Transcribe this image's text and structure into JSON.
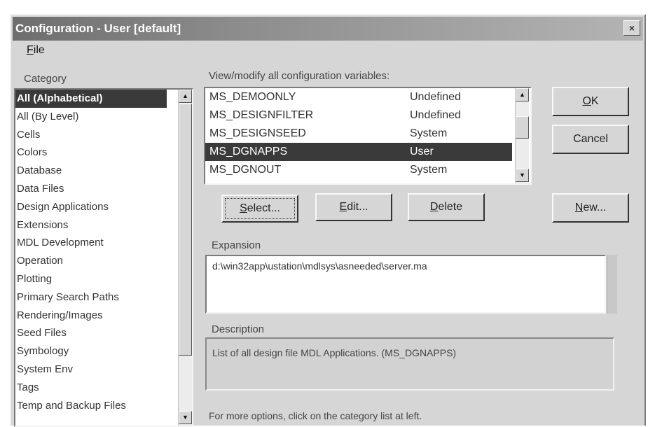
{
  "window": {
    "title": "Configuration - User [default]",
    "close_glyph": "×"
  },
  "menu": {
    "file_mnemonic": "F",
    "file_rest": "ile"
  },
  "category": {
    "label": "Category",
    "items": [
      "All (Alphabetical)",
      "All (By Level)",
      "Cells",
      "Colors",
      "Database",
      "Data Files",
      "Design Applications",
      "Extensions",
      "MDL Development",
      "Operation",
      "Plotting",
      "Primary Search Paths",
      "Rendering/Images",
      "Seed Files",
      "Symbology",
      "System Env",
      "Tags",
      "Temp and Backup Files"
    ],
    "selected_index": 0
  },
  "variables": {
    "label": "View/modify all configuration variables:",
    "rows": [
      {
        "name": "MS_DEMOONLY",
        "level": "Undefined"
      },
      {
        "name": "MS_DESIGNFILTER",
        "level": "Undefined"
      },
      {
        "name": "MS_DESIGNSEED",
        "level": "System"
      },
      {
        "name": "MS_DGNAPPS",
        "level": "User"
      },
      {
        "name": "MS_DGNOUT",
        "level": "System"
      }
    ],
    "selected_index": 3
  },
  "buttons": {
    "ok": {
      "mnemonic": "O",
      "rest": "K"
    },
    "cancel": "Cancel",
    "select": {
      "mnemonic": "S",
      "rest": "elect..."
    },
    "edit": {
      "mnemonic": "E",
      "rest": "dit..."
    },
    "delete": {
      "mnemonic": "D",
      "rest": "elete"
    },
    "new": {
      "mnemonic": "N",
      "rest": "ew..."
    }
  },
  "expansion": {
    "label": "Expansion",
    "value": "d:\\win32app\\ustation\\mdlsys\\asneeded\\server.ma"
  },
  "description": {
    "label": "Description",
    "text": "List of all design file MDL Applications. (MS_DGNAPPS)"
  },
  "footer_hint": "For more options, click on the category list at left.",
  "scroll_arrows": {
    "up": "▲",
    "down": "▼"
  }
}
